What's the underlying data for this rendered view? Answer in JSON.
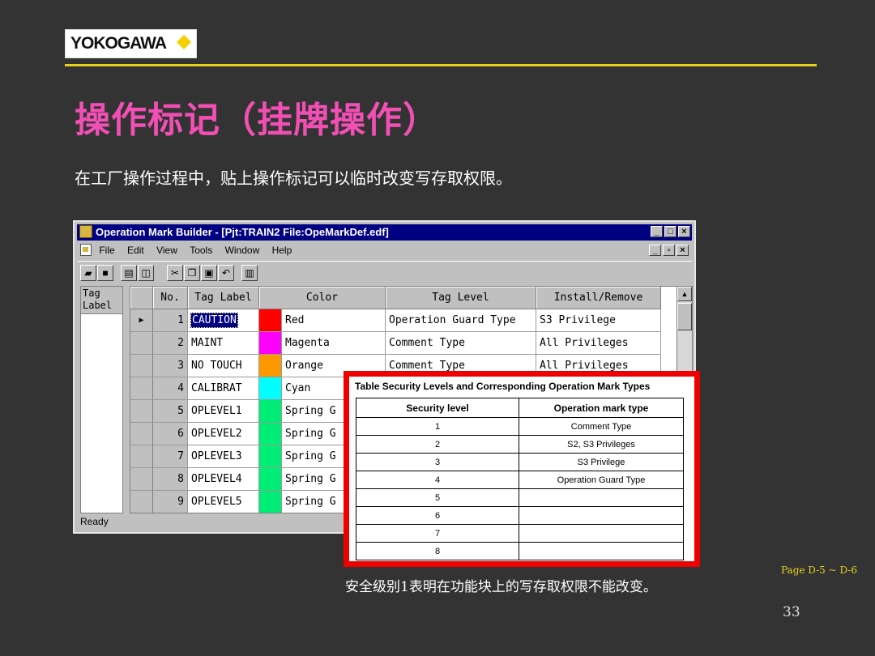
{
  "logo": {
    "text": "YOKOGAWA",
    "diamond_color": "#f5d000"
  },
  "title": "操作标记（挂牌操作）",
  "subtitle": "在工厂操作过程中，贴上操作标记可以临时改变写存取权限。",
  "window": {
    "title": "Operation Mark Builder - [Pjt:TRAIN2 File:OpeMarkDef.edf]",
    "menu": [
      "File",
      "Edit",
      "View",
      "Tools",
      "Window",
      "Help"
    ],
    "left_panel_header": [
      "Tag",
      "Label"
    ],
    "columns": [
      "No.",
      "Tag Label",
      "Color",
      "Tag Level",
      "Install/Remove"
    ],
    "rows": [
      {
        "no": "1",
        "label": "CAUTION",
        "color_hex": "#ff0000",
        "color": "Red",
        "level": "Operation Guard Type",
        "install": "S3 Privilege",
        "selected": true
      },
      {
        "no": "2",
        "label": "MAINT",
        "color_hex": "#ff00ff",
        "color": "Magenta",
        "level": "Comment Type",
        "install": "All Privileges"
      },
      {
        "no": "3",
        "label": "NO TOUCH",
        "color_hex": "#ff9900",
        "color": "Orange",
        "level": "Comment Type",
        "install": "All Privileges"
      },
      {
        "no": "4",
        "label": "CALIBRAT",
        "color_hex": "#00ffff",
        "color": "Cyan",
        "level": "",
        "install": ""
      },
      {
        "no": "5",
        "label": "OPLEVEL1",
        "color_hex": "#00ee77",
        "color": "Spring G",
        "level": "",
        "install": ""
      },
      {
        "no": "6",
        "label": "OPLEVEL2",
        "color_hex": "#00ee77",
        "color": "Spring G",
        "level": "",
        "install": ""
      },
      {
        "no": "7",
        "label": "OPLEVEL3",
        "color_hex": "#00ee77",
        "color": "Spring G",
        "level": "",
        "install": ""
      },
      {
        "no": "8",
        "label": "OPLEVEL4",
        "color_hex": "#00ee77",
        "color": "Spring G",
        "level": "",
        "install": ""
      },
      {
        "no": "9",
        "label": "OPLEVEL5",
        "color_hex": "#00ee77",
        "color": "Spring G",
        "level": "",
        "install": ""
      }
    ],
    "status": "Ready"
  },
  "security_table": {
    "caption": "Table  Security Levels and Corresponding Operation Mark Types",
    "headers": [
      "Security level",
      "Operation mark type"
    ],
    "rows": [
      [
        "1",
        "Comment Type"
      ],
      [
        "2",
        "S2, S3 Privileges"
      ],
      [
        "3",
        "S3 Privilege"
      ],
      [
        "4",
        "Operation Guard Type"
      ],
      [
        "5",
        ""
      ],
      [
        "6",
        ""
      ],
      [
        "7",
        ""
      ],
      [
        "8",
        ""
      ]
    ]
  },
  "page_ref": "Page D-5 ~ D-6",
  "note": "安全级别1表明在功能块上的写存取权限不能改变。",
  "page_number": "33"
}
